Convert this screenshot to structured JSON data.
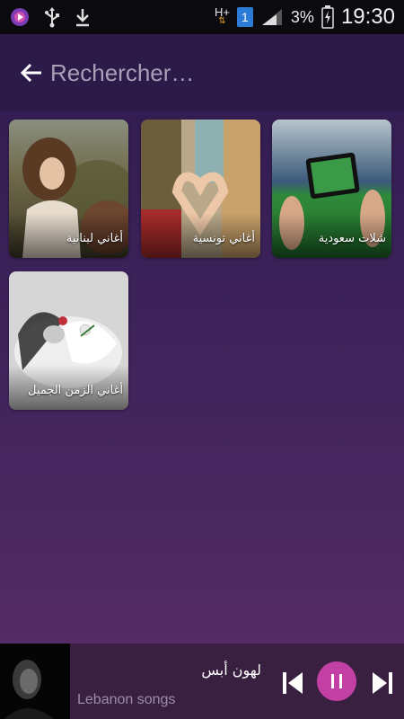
{
  "status_bar": {
    "network_label": "H+",
    "sim_label": "1",
    "battery_percent": "3%",
    "time": "19:30",
    "icons": [
      "app-icon",
      "usb-icon",
      "download-icon",
      "data-arrows-icon",
      "signal-icon",
      "battery-charging-icon"
    ]
  },
  "search": {
    "placeholder": "Rechercher…",
    "back_icon": "arrow-left-icon"
  },
  "categories": [
    {
      "label": "أغاني لبنانية"
    },
    {
      "label": "أغاني تونسية"
    },
    {
      "label": "شلات سعودية"
    },
    {
      "label": "أغاني الزمن الجميل"
    }
  ],
  "player": {
    "title": "لهون أبس",
    "subtitle": "Lebanon songs",
    "accent_color": "#c23fa4",
    "state": "playing"
  }
}
